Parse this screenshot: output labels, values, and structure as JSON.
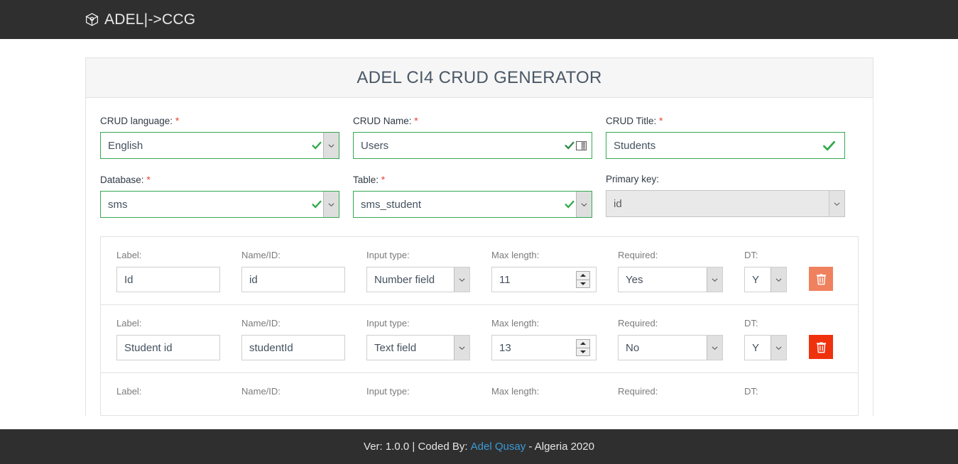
{
  "navbar": {
    "brand_text": "ADEL|->CCG",
    "brand_icon": "cube-icon",
    "background": "#2f2f2f"
  },
  "card": {
    "title": "ADEL CI4 CRUD GENERATOR"
  },
  "form": {
    "required_marker": "*",
    "rows": [
      {
        "fields": [
          {
            "label": "CRUD language:",
            "required": true,
            "type": "select",
            "value": "English",
            "state": "valid",
            "valid_check": true,
            "dropdown": true
          },
          {
            "label": "CRUD Name:",
            "required": true,
            "type": "text",
            "value": "Users",
            "state": "valid",
            "valid_check": true,
            "autofill_icon": true
          },
          {
            "label": "CRUD Title:",
            "required": true,
            "type": "text",
            "value": "Students",
            "state": "valid",
            "valid_check": true
          }
        ]
      },
      {
        "fields": [
          {
            "label": "Database:",
            "required": true,
            "type": "select",
            "value": "sms",
            "state": "valid",
            "valid_check": true,
            "dropdown": true
          },
          {
            "label": "Table:",
            "required": true,
            "type": "select",
            "value": "sms_student",
            "state": "valid",
            "valid_check": true,
            "dropdown": true
          },
          {
            "label": "Primary key:",
            "required": false,
            "type": "select",
            "value": "id",
            "state": "disabled",
            "dropdown": true
          }
        ]
      }
    ]
  },
  "fields_section": {
    "column_labels": {
      "label": "Label:",
      "name_id": "Name/ID:",
      "input_type": "Input type:",
      "max_length": "Max length:",
      "required": "Required:",
      "dt": "DT:"
    },
    "delete_icon": "trash-icon",
    "rows": [
      {
        "label": "Id",
        "name_id": "id",
        "input_type": "Number field",
        "max_length": "11",
        "required": "Yes",
        "dt": "Y",
        "delete_color": "#f0815f"
      },
      {
        "label": "Student id",
        "name_id": "studentId",
        "input_type": "Text field",
        "max_length": "13",
        "required": "No",
        "dt": "Y",
        "delete_color": "#f0310e"
      }
    ]
  },
  "footer": {
    "version_text": "Ver: 1.0.0 | Coded By:",
    "author_link": "Adel Qusay",
    "suffix_text": "- Algeria 2020"
  }
}
